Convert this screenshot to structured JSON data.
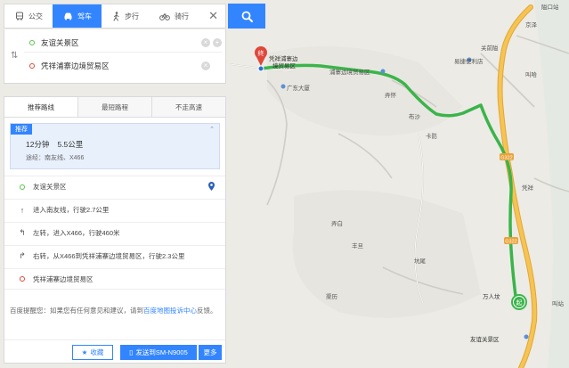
{
  "modes": [
    {
      "label": "公交",
      "icon": "bus-icon"
    },
    {
      "label": "驾车",
      "icon": "car-icon",
      "active": true
    },
    {
      "label": "步行",
      "icon": "walk-icon"
    },
    {
      "label": "骑行",
      "icon": "bike-icon"
    }
  ],
  "close_label": "✕",
  "start": "友谊关景区",
  "end": "凭祥浦寨边境贸易区",
  "tabs": [
    "推荐路线",
    "最短路程",
    "不走高速"
  ],
  "recommended": {
    "badge": "推荐",
    "time": "12分钟",
    "distance": "5.5公里",
    "via": "途经：南友线、X466"
  },
  "steps": [
    {
      "icon": "start-dot",
      "text": "友谊关景区"
    },
    {
      "icon": "arrow-up-icon",
      "text": "进入南友线，行驶2.7公里"
    },
    {
      "icon": "turn-left-icon",
      "text": "左转，进入X466，行驶460米"
    },
    {
      "icon": "turn-right-icon",
      "text": "右转，从X466到凭祥浦寨边境贸易区，行驶2.3公里"
    },
    {
      "icon": "end-dot",
      "text": "凭祥浦寨边境贸易区"
    }
  ],
  "feedback": {
    "text": "百度提醒您：如果您有任何意见和建议，请到",
    "link": "百度地图投诉中心",
    "suffix": "反馈。"
  },
  "actions": {
    "favorite": "收藏",
    "send": "发送到SM-N9005",
    "more": "更多"
  },
  "map_labels": {
    "start_marker": "终",
    "end_marker": "起",
    "dest_label_line1": "凭祥浦寨边",
    "dest_label_line2": "境贸易区",
    "pois": [
      "广东大厦",
      "浦寨边境贸易区",
      "隘口站",
      "关前隘",
      "易捷便利店",
      "叫哈",
      "弄怀",
      "布沙",
      "卡防",
      "凭祥",
      "弄白",
      "丰旦",
      "坑尾",
      "渠历",
      "万人坟",
      "友谊关景区",
      "叫站",
      "京泽"
    ],
    "road_labels": [
      "G322",
      "G322"
    ]
  },
  "colors": {
    "accent": "#3385ff",
    "route": "#3bb44a",
    "highway": "#f2b33d"
  }
}
